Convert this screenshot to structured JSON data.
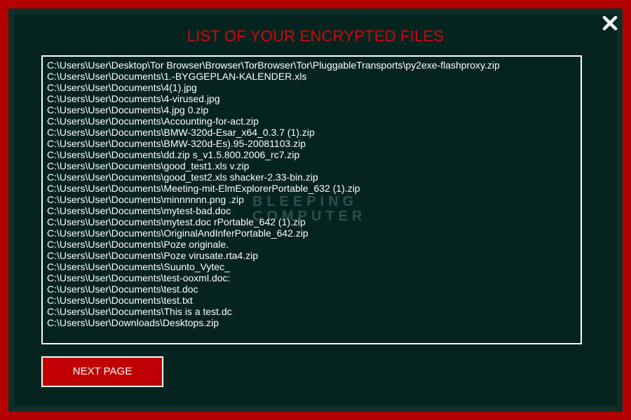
{
  "header": {
    "title": "LIST OF YOUR ENCRYPTED FILES"
  },
  "files": [
    "C:\\Users\\User\\Desktop\\Tor Browser\\Browser\\TorBrowser\\Tor\\PluggableTransports\\py2exe-flashproxy.zip",
    "C:\\Users\\User\\Documents\\1.-BYGGEPLAN-KALENDER.xls",
    "C:\\Users\\User\\Documents\\4(1).jpg",
    "C:\\Users\\User\\Documents\\4-virused.jpg",
    "C:\\Users\\User\\Documents\\4.jpg                    0.zip",
    "C:\\Users\\User\\Documents\\Accounting-for-act.zip",
    "C:\\Users\\User\\Documents\\BMW-320d-Esar_x64_0.3.7 (1).zip",
    "C:\\Users\\User\\Documents\\BMW-320d-Es).95-20081103.zip",
    "C:\\Users\\User\\Documents\\dd.zip                   s_v1.5.800.2006_rc7.zip",
    "C:\\Users\\User\\Documents\\good_test1.xls v.zip",
    "C:\\Users\\User\\Documents\\good_test2.xls shacker-2.33-bin.zip",
    "C:\\Users\\User\\Documents\\Meeting-mit-ElmExplorerPortable_632 (1).zip",
    "C:\\Users\\User\\Documents\\minnnnnn.png .zip",
    "C:\\Users\\User\\Documents\\mytest-bad.doc",
    "C:\\Users\\User\\Documents\\mytest.doc         rPortable_642 (1).zip",
    "C:\\Users\\User\\Documents\\OriginalAndInferPortable_642.zip",
    "C:\\Users\\User\\Documents\\Poze originale.",
    "C:\\Users\\User\\Documents\\Poze virusate.rta4.zip",
    "C:\\Users\\User\\Documents\\Suunto_Vytec_",
    "C:\\Users\\User\\Documents\\test-ooxml.doc:",
    "C:\\Users\\User\\Documents\\test.doc",
    "C:\\Users\\User\\Documents\\test.txt",
    "C:\\Users\\User\\Documents\\This is a test.dc",
    "C:\\Users\\User\\Downloads\\Desktops.zip"
  ],
  "watermark": {
    "line1": "BLEEPING",
    "line2": "COMPUTER"
  },
  "buttons": {
    "next_label": "NEXT PAGE"
  },
  "icons": {
    "close": "close-icon"
  },
  "colors": {
    "border": "#b40000",
    "background": "#06241f",
    "title": "#c90a0a",
    "button": "#c00000",
    "text": "#ffffff"
  }
}
